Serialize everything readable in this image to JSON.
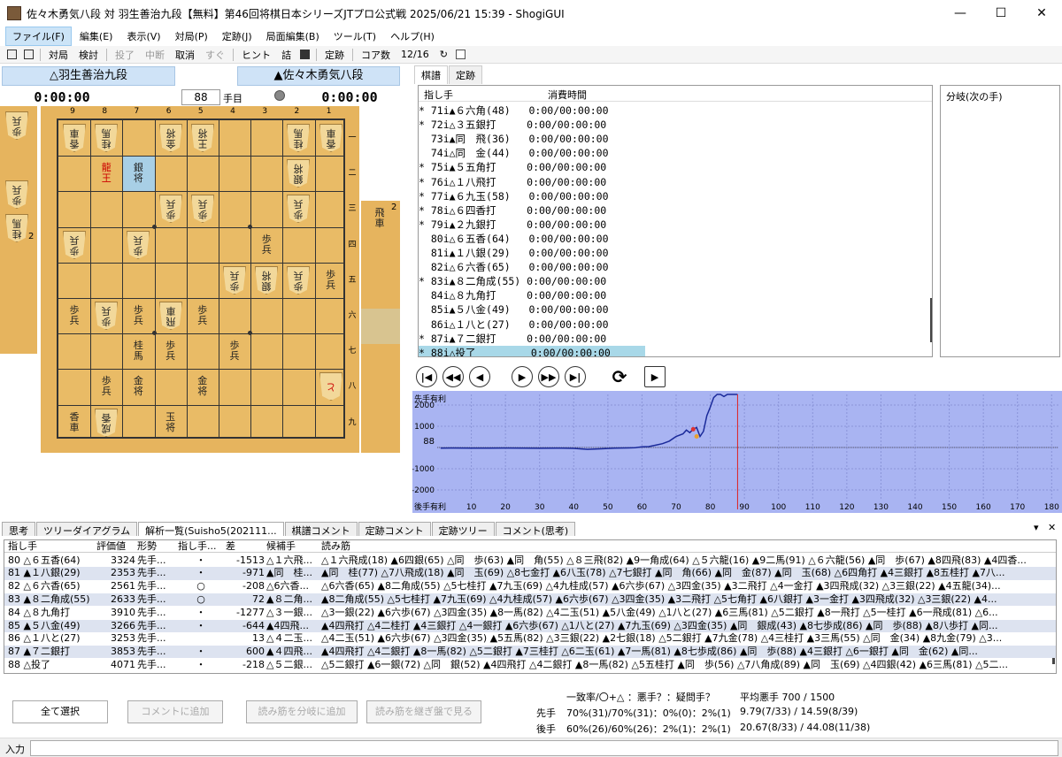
{
  "window": {
    "title": "佐々木勇気八段 対 羽生善治九段【無料】第46回将棋日本シリーズJTプロ公式戦 2025/06/21 15:39 - ShogiGUI",
    "min": "—",
    "max": "☐",
    "close": "✕"
  },
  "menu": [
    "ファイル(F)",
    "編集(E)",
    "表示(V)",
    "対局(P)",
    "定跡(J)",
    "局面編集(B)",
    "ツール(T)",
    "ヘルプ(H)"
  ],
  "toolbar": {
    "taikyoku": "対局",
    "kento": "検討",
    "resign": "投了",
    "pause": "中断",
    "undo": "取消",
    "now": "すぐ",
    "hint": "ヒント",
    "tsume": "詰",
    "joseki": "定跡",
    "core_label": "コア数",
    "core_value": "12/16"
  },
  "players": {
    "gote": "△羽生善治九段",
    "sente": "▲佐々木勇気八段",
    "gote_time": "0:00:00",
    "sente_time": "0:00:00",
    "move_number": "88",
    "move_label": "手目"
  },
  "board": {
    "files": [
      "9",
      "8",
      "7",
      "6",
      "5",
      "4",
      "3",
      "2",
      "1"
    ],
    "ranks": [
      "一",
      "二",
      "三",
      "四",
      "五",
      "六",
      "七",
      "八",
      "九"
    ],
    "pieces": [
      {
        "f": 9,
        "r": 1,
        "t": "香車",
        "g": true
      },
      {
        "f": 8,
        "r": 1,
        "t": "桂馬",
        "g": true
      },
      {
        "f": 6,
        "r": 1,
        "t": "金将",
        "g": true
      },
      {
        "f": 5,
        "r": 1,
        "t": "王将",
        "g": true
      },
      {
        "f": 2,
        "r": 1,
        "t": "桂馬",
        "g": true
      },
      {
        "f": 1,
        "r": 1,
        "t": "香車",
        "g": true
      },
      {
        "f": 8,
        "r": 2,
        "t": "龍王",
        "g": false,
        "p": true
      },
      {
        "f": 7,
        "r": 2,
        "t": "銀将",
        "g": false
      },
      {
        "f": 2,
        "r": 2,
        "t": "銀将",
        "g": true
      },
      {
        "f": 6,
        "r": 3,
        "t": "歩兵",
        "g": true
      },
      {
        "f": 5,
        "r": 3,
        "t": "歩兵",
        "g": true
      },
      {
        "f": 2,
        "r": 3,
        "t": "歩兵",
        "g": true
      },
      {
        "f": 9,
        "r": 4,
        "t": "歩兵",
        "g": true
      },
      {
        "f": 7,
        "r": 4,
        "t": "歩兵",
        "g": true
      },
      {
        "f": 3,
        "r": 4,
        "t": "歩兵",
        "g": false
      },
      {
        "f": 4,
        "r": 5,
        "t": "歩兵",
        "g": true
      },
      {
        "f": 3,
        "r": 5,
        "t": "銀将",
        "g": true
      },
      {
        "f": 2,
        "r": 5,
        "t": "歩兵",
        "g": true
      },
      {
        "f": 1,
        "r": 5,
        "t": "歩兵",
        "g": false
      },
      {
        "f": 9,
        "r": 6,
        "t": "歩兵",
        "g": false
      },
      {
        "f": 8,
        "r": 6,
        "t": "歩兵",
        "g": true
      },
      {
        "f": 7,
        "r": 6,
        "t": "歩兵",
        "g": false
      },
      {
        "f": 6,
        "r": 6,
        "t": "飛車",
        "g": true
      },
      {
        "f": 5,
        "r": 6,
        "t": "歩兵",
        "g": false
      },
      {
        "f": 7,
        "r": 7,
        "t": "桂馬",
        "g": false
      },
      {
        "f": 6,
        "r": 7,
        "t": "歩兵",
        "g": false
      },
      {
        "f": 4,
        "r": 7,
        "t": "歩兵",
        "g": false
      },
      {
        "f": 8,
        "r": 8,
        "t": "歩兵",
        "g": false
      },
      {
        "f": 7,
        "r": 8,
        "t": "金将",
        "g": false
      },
      {
        "f": 5,
        "r": 8,
        "t": "金将",
        "g": false
      },
      {
        "f": 1,
        "r": 8,
        "t": "と",
        "g": true,
        "p": true
      },
      {
        "f": 9,
        "r": 9,
        "t": "香車",
        "g": false
      },
      {
        "f": 8,
        "r": 9,
        "t": "成香",
        "g": true
      },
      {
        "f": 6,
        "r": 9,
        "t": "玉将",
        "g": false
      }
    ],
    "highlight": {
      "f": 7,
      "r": 2
    },
    "gote_hand": [
      {
        "t": "歩兵",
        "n": ""
      },
      {
        "t": "歩兵",
        "n": ""
      },
      {
        "t": "桂馬",
        "n": "2"
      }
    ],
    "sente_hand": [
      {
        "t": "飛車",
        "n": "2"
      }
    ]
  },
  "kifu": {
    "tabs": [
      "棋譜",
      "定跡"
    ],
    "col_move": "指し手",
    "col_time": "消費時間",
    "rows": [
      "* 71i▲６六角(48)   0:00/00:00:00",
      "* 72i△３五銀打     0:00/00:00:00",
      "  73i▲同　飛(36)   0:00/00:00:00",
      "  74i△同　金(44)   0:00/00:00:00",
      "* 75i▲５五角打     0:00/00:00:00",
      "* 76i△１八飛打     0:00/00:00:00",
      "* 77i▲６九玉(58)   0:00/00:00:00",
      "* 78i△６四香打     0:00/00:00:00",
      "* 79i▲２九銀打     0:00/00:00:00",
      "  80i△６五香(64)   0:00/00:00:00",
      "  81i▲１八銀(29)   0:00/00:00:00",
      "  82i△６六香(65)   0:00/00:00:00",
      "* 83i▲８二角成(55) 0:00/00:00:00",
      "  84i△８九角打     0:00/00:00:00",
      "  85i▲５八金(49)   0:00/00:00:00",
      "  86i△１八と(27)   0:00/00:00:00",
      "* 87i▲７二銀打     0:00/00:00:00",
      "* 88i△投了         0:00/00:00:00"
    ],
    "selected": 17,
    "branch_label": "分岐(次の手)"
  },
  "graph": {
    "top_label": "先手有利",
    "bottom_label": "後手有利",
    "current_value": "88",
    "yticks": [
      "2000",
      "1000",
      "0",
      "-1000",
      "-2000"
    ],
    "xticks": [
      "10",
      "20",
      "30",
      "40",
      "50",
      "60",
      "70",
      "80",
      "90",
      "100",
      "110",
      "120",
      "130",
      "140",
      "150",
      "160",
      "170",
      "180"
    ],
    "ymin": -2500,
    "ymax": 2500,
    "xmax": 182,
    "current_move": 88,
    "series": [
      [
        1,
        -30
      ],
      [
        5,
        -25
      ],
      [
        10,
        -30
      ],
      [
        15,
        -30
      ],
      [
        20,
        -28
      ],
      [
        25,
        -30
      ],
      [
        30,
        -35
      ],
      [
        35,
        -30
      ],
      [
        40,
        -40
      ],
      [
        44,
        -90
      ],
      [
        48,
        -60
      ],
      [
        52,
        -30
      ],
      [
        56,
        -20
      ],
      [
        58,
        -10
      ],
      [
        60,
        30
      ],
      [
        62,
        40
      ],
      [
        64,
        110
      ],
      [
        66,
        180
      ],
      [
        68,
        300
      ],
      [
        70,
        520
      ],
      [
        72,
        640
      ],
      [
        73,
        820
      ],
      [
        74,
        700
      ],
      [
        75,
        860
      ],
      [
        76,
        940
      ],
      [
        77,
        520
      ],
      [
        78,
        760
      ],
      [
        79,
        1500
      ],
      [
        80,
        1900
      ],
      [
        81,
        2353
      ],
      [
        82,
        2561
      ],
      [
        83,
        2633
      ],
      [
        84,
        2400
      ],
      [
        85,
        2600
      ],
      [
        86,
        3253
      ],
      [
        87,
        3853
      ],
      [
        88,
        4071
      ]
    ],
    "markers": [
      [
        75,
        860,
        "#d33"
      ],
      [
        76,
        520,
        "#e8a030"
      ]
    ]
  },
  "bottom": {
    "tabs": [
      "思考",
      "ツリーダイアグラム",
      "解析一覧(Suisho5(202111...",
      "棋譜コメント",
      "定跡コメント",
      "定跡ツリー",
      "コメント(思考)"
    ],
    "active_tab": 2,
    "headers": [
      "指し手",
      "評価値",
      "形勢",
      "指し手...",
      "差",
      "候補手",
      "読み筋"
    ],
    "rows": [
      [
        "80 △６五香(64)",
        "3324",
        "先手...",
        "・",
        "-1513",
        "△１六飛...",
        "△１六飛成(18) ▲6四銀(65) △同　歩(63) ▲同　角(55) △８三飛(82) ▲9一角成(64) △５六龍(16) ▲9二馬(91) △６六龍(56) ▲同　歩(67) ▲8四飛(83) ▲4四香..."
      ],
      [
        "81 ▲１八銀(29)",
        "2353",
        "先手...",
        "・",
        "-971",
        "▲同　桂...",
        "▲同　桂(77) △7八飛成(18) ▲同　玉(69) △8七金打 ▲6八玉(78) △7七銀打 ▲同　角(66) ▲同　金(87) ▲同　玉(68) △6四角打 ▲4三銀打 ▲8五桂打 ▲7八..."
      ],
      [
        "82 △６六香(65)",
        "2561",
        "先手...",
        "○",
        "-208",
        "△6六香...",
        "△6六香(65) ▲8二角成(55) △5七桂打 ▲7九玉(69) △4九桂成(57) ▲6六歩(67) △3四金(35) ▲3二飛打 △4一金打 ▲3四飛成(32) △3三銀(22) ▲4五龍(34)..."
      ],
      [
        "83 ▲８二角成(55)",
        "2633",
        "先手...",
        "○",
        "72",
        "▲８二角...",
        "▲8二角成(55) △5七桂打 ▲7九玉(69) △4九桂成(57) ▲6六歩(67) △3四金(35) ▲3二飛打 △5七角打 ▲6八銀打 ▲3一金打 ▲3四飛成(32) △3三銀(22) ▲4..."
      ],
      [
        "84 △８九角打",
        "3910",
        "先手...",
        "・",
        "-1277",
        "△３一銀...",
        "△3一銀(22) ▲6六歩(67) △3四金(35) ▲8一馬(82) △4二玉(51) ▲5八金(49) △1八と(27) ▲6三馬(81) △5二銀打 ▲8一飛打 △5一桂打 ▲6一飛成(81) △6..."
      ],
      [
        "85 ▲５八金(49)",
        "3266",
        "先手...",
        "・",
        "-644",
        "▲4四飛...",
        "▲4四飛打 △4二桂打 ▲4三銀打 △4一銀打 ▲6六歩(67) △1八と(27) ▲7九玉(69) △3四金(35) ▲同　銀成(43) ▲8七歩成(86) ▲同　歩(88) ▲8八歩打 ▲同..."
      ],
      [
        "86 △１八と(27)",
        "3253",
        "先手...",
        "",
        "13",
        "△４二玉...",
        "△4二玉(51) ▲6六歩(67) △3四金(35) ▲5五馬(82) △3三銀(22) ▲2七銀(18) △5二銀打 ▲7九金(78) △4三桂打 ▲3三馬(55) △同　金(34) ▲8九金(79) △3..."
      ],
      [
        "87 ▲７二銀打",
        "3853",
        "先手...",
        "・",
        "600",
        "▲４四飛...",
        "▲4四飛打 △4二銀打 ▲8一馬(82) △5二銀打 ▲7三桂打 △6二玉(61) ▲7一馬(81) ▲8七歩成(86) ▲同　歩(88) ▲4三銀打 △6一銀打 ▲同　金(62) ▲同..."
      ],
      [
        "88 △投了",
        "4071",
        "先手...",
        "・",
        "-218",
        "△５二銀...",
        "△5二銀打 ▲6一銀(72) △同　銀(52) ▲4四飛打 △4二銀打 ▲8一馬(82) △5五桂打 ▲同　歩(56) △7八角成(89) ▲同　玉(69) △4四銀(42) ▲6三馬(81) △5二..."
      ]
    ],
    "buttons": [
      "全て選択",
      "コメントに追加",
      "読み筋を分岐に追加",
      "読み筋を継ぎ盤で見る"
    ],
    "stats": {
      "hdr1": "一致率/〇+△ ：悪手？：疑問手？",
      "hdr2": "平均悪手 700 / 1500",
      "sente_label": "先手",
      "sente_match": "70%(31)/70%(31)：0%(0)：2%(1)",
      "sente_avg": "9.79(7/33) / 14.59(8/39)",
      "gote_label": "後手",
      "gote_match": "60%(26)/60%(26)：2%(1)：2%(1)",
      "gote_avg": "20.67(8/33) / 44.08(11/38)"
    },
    "input_label": "入力"
  }
}
